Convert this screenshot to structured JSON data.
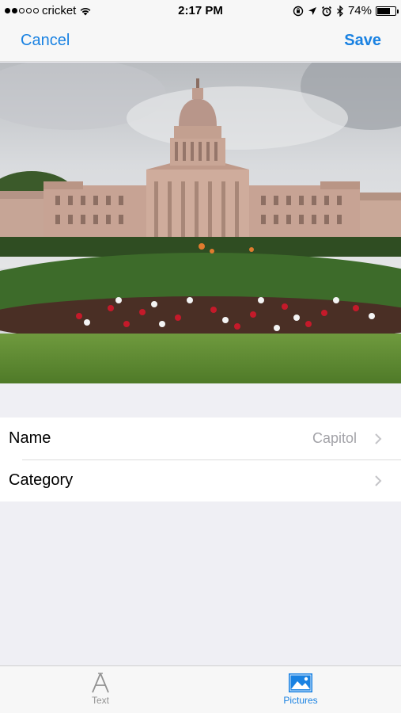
{
  "status_bar": {
    "carrier": "cricket",
    "time": "2:17 PM",
    "battery": "74%",
    "battery_level": 0.74,
    "signal_bars_filled": 2,
    "signal_bars_total": 5
  },
  "nav": {
    "cancel_label": "Cancel",
    "save_label": "Save"
  },
  "photo": {
    "subject": "Texas State Capitol building with flower garden"
  },
  "form": {
    "rows": [
      {
        "label": "Name",
        "value": "Capitol"
      },
      {
        "label": "Category",
        "value": ""
      }
    ]
  },
  "tab_bar": {
    "tabs": [
      {
        "label": "Text",
        "icon": "text-a-icon",
        "selected": false
      },
      {
        "label": "Pictures",
        "icon": "picture-icon",
        "selected": true
      }
    ]
  },
  "colors": {
    "accent": "#1a82e2",
    "background": "#efeff4",
    "secondary_text": "#a3a3a8"
  }
}
